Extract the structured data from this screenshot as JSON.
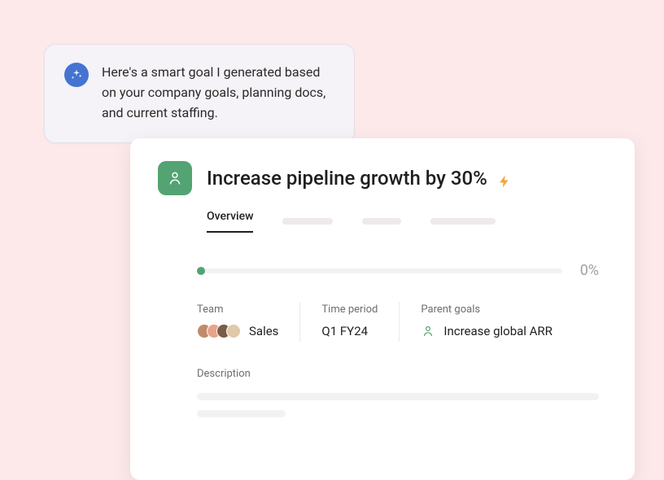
{
  "callout": {
    "text": "Here's a smart goal I generated based on your company goals, planning docs, and current staffing."
  },
  "goal": {
    "title": "Increase pipeline growth by 30%",
    "tabs": {
      "overview": "Overview"
    },
    "progress": {
      "percent_label": "0%",
      "percent_value": 0
    },
    "meta": {
      "team": {
        "label": "Team",
        "value": "Sales"
      },
      "time_period": {
        "label": "Time period",
        "value": "Q1 FY24"
      },
      "parent_goals": {
        "label": "Parent goals",
        "value": "Increase global ARR"
      }
    },
    "description": {
      "label": "Description"
    }
  }
}
